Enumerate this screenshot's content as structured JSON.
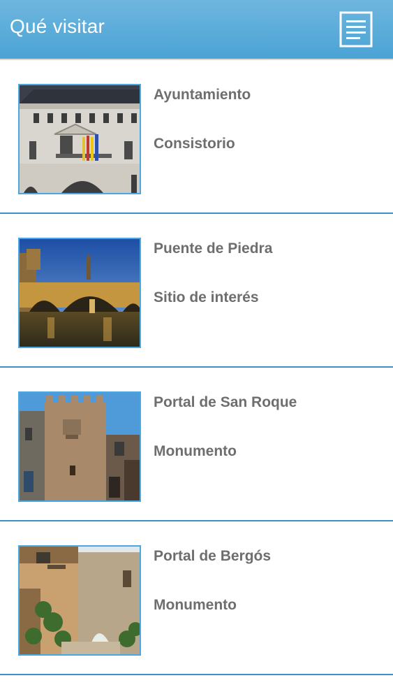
{
  "header": {
    "title": "Qué visitar",
    "menu_icon": "list-menu-icon",
    "accent": "#4aa3d4"
  },
  "items": [
    {
      "title": "Ayuntamiento",
      "subtitle": "Consistorio",
      "image": "town-hall-photo"
    },
    {
      "title": "Puente de Piedra",
      "subtitle": "Sitio de interés",
      "image": "stone-bridge-photo"
    },
    {
      "title": "Portal de San Roque",
      "subtitle": "Monumento",
      "image": "san-roque-gate-photo"
    },
    {
      "title": "Portal de Bergós",
      "subtitle": "Monumento",
      "image": "bergos-gate-photo"
    }
  ],
  "colors": {
    "separator": "#3f8ec8",
    "thumb_border": "#4aa7e0",
    "text": "#6e6e6e"
  }
}
